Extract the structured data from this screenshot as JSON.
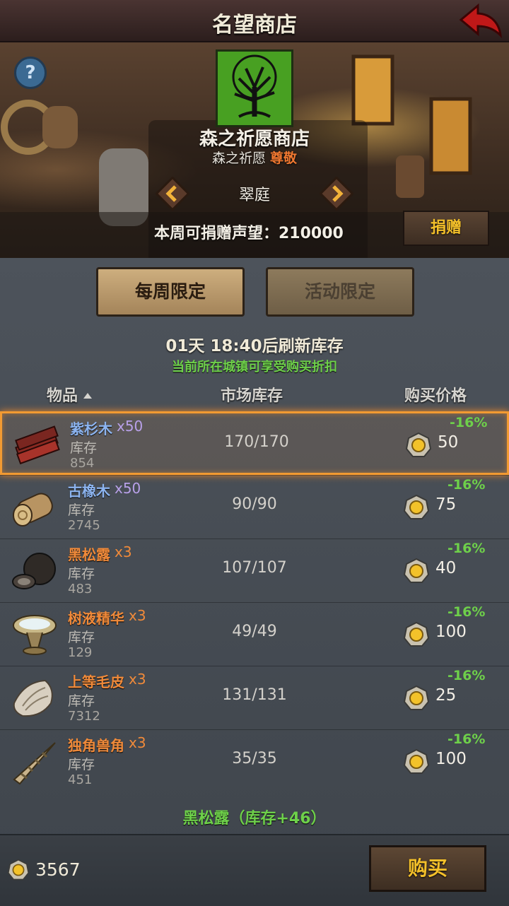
{
  "title": "名望商店",
  "shop": {
    "name": "森之祈愿商店",
    "faction": "森之祈愿",
    "rep_level": "尊敬",
    "town": "翠庭",
    "donate_text": "本周可捐赠声望：210000",
    "donate_label": "捐赠"
  },
  "help_label": "?",
  "tabs": [
    {
      "label": "每周限定",
      "active": true
    },
    {
      "label": "活动限定",
      "active": false
    }
  ],
  "refresh_text": "01天 18:40后刷新库存",
  "discount_note": "当前所在城镇可享受购买折扣",
  "columns": {
    "item": "物品",
    "stock": "市场库存",
    "price": "购买价格"
  },
  "items": [
    {
      "name": "紫杉木",
      "qty": "x50",
      "stock_label": "库存",
      "stock": "854",
      "market": "170/170",
      "price": "50",
      "discount": "-16%",
      "name_color": "#8cb4f0",
      "icon": "yew-wood-icon"
    },
    {
      "name": "古橡木",
      "qty": "x50",
      "stock_label": "库存",
      "stock": "2745",
      "market": "90/90",
      "price": "75",
      "discount": "-16%",
      "name_color": "#8cb4f0",
      "icon": "ancient-oak-icon"
    },
    {
      "name": "黑松露",
      "qty": "x3",
      "stock_label": "库存",
      "stock": "483",
      "market": "107/107",
      "price": "40",
      "discount": "-16%",
      "name_color": "#f08a3a",
      "icon": "black-truffle-icon"
    },
    {
      "name": "树液精华",
      "qty": "x3",
      "stock_label": "库存",
      "stock": "129",
      "market": "49/49",
      "price": "100",
      "discount": "-16%",
      "name_color": "#f08a3a",
      "icon": "sap-essence-icon"
    },
    {
      "name": "上等毛皮",
      "qty": "x3",
      "stock_label": "库存",
      "stock": "7312",
      "market": "131/131",
      "price": "25",
      "discount": "-16%",
      "name_color": "#f08a3a",
      "icon": "fur-icon"
    },
    {
      "name": "独角兽角",
      "qty": "x3",
      "stock_label": "库存",
      "stock": "451",
      "market": "35/35",
      "price": "100",
      "discount": "-16%",
      "name_color": "#f08a3a",
      "icon": "unicorn-horn-icon"
    }
  ],
  "footer_note": "黑松露（库存+46）",
  "wallet": "3567",
  "buy_label": "购买"
}
